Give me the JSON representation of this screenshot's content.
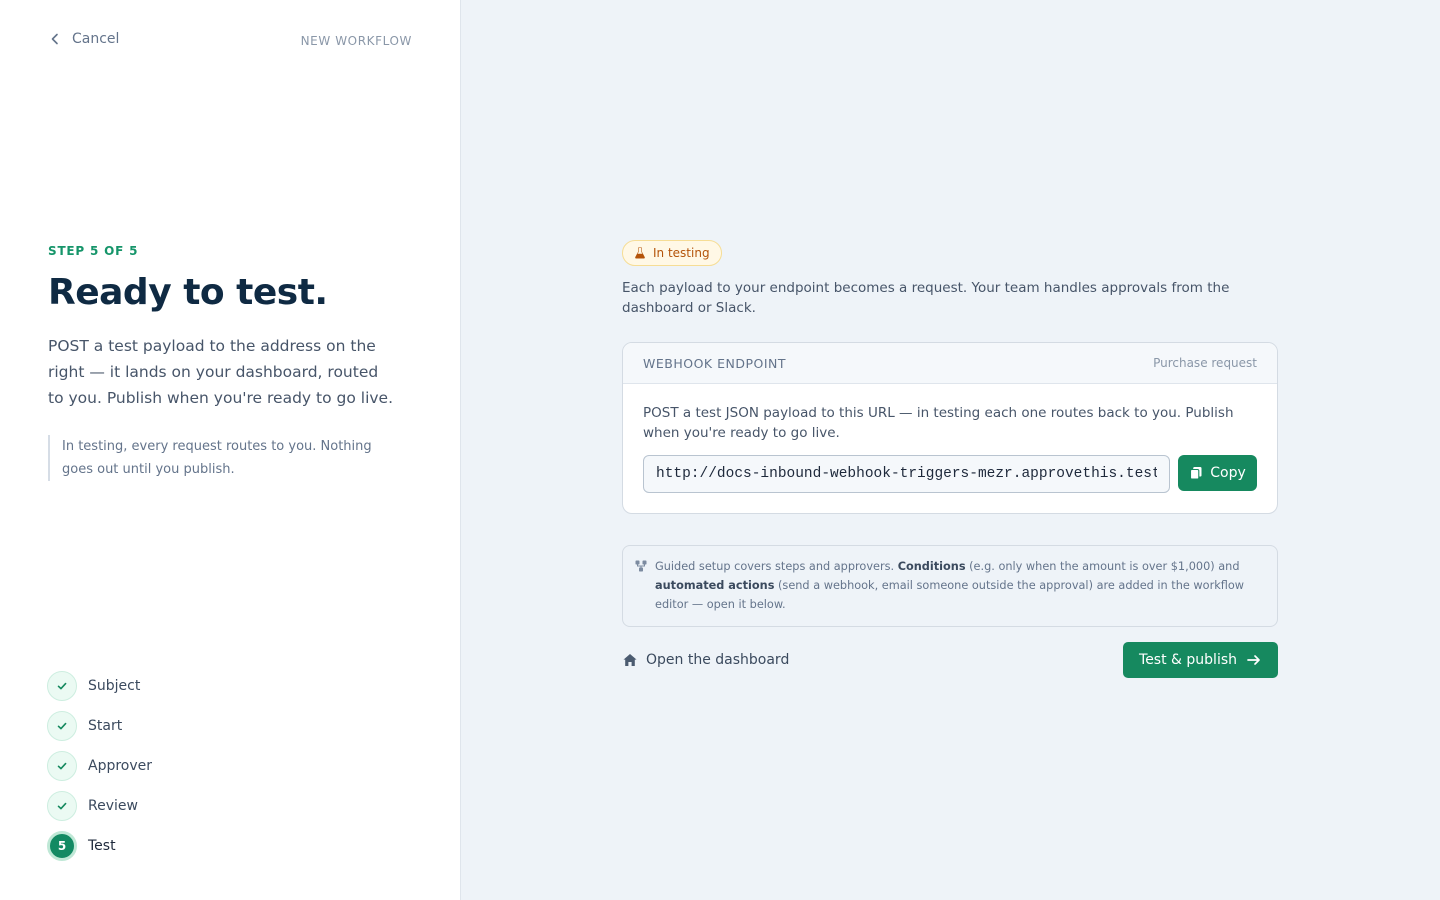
{
  "header": {
    "cancel_label": "Cancel",
    "context_label": "NEW WORKFLOW"
  },
  "intro": {
    "step_counter": "STEP 5 OF 5",
    "title": "Ready to test.",
    "description": "POST a test payload to the address on the right — it lands on your dashboard, routed to you. Publish when you're ready to go live.",
    "note": "In testing, every request routes to you. Nothing goes out until you publish."
  },
  "steps": [
    {
      "label": "Subject",
      "status": "done"
    },
    {
      "label": "Start",
      "status": "done"
    },
    {
      "label": "Approver",
      "status": "done"
    },
    {
      "label": "Review",
      "status": "done"
    },
    {
      "label": "Test",
      "status": "active",
      "number": "5"
    }
  ],
  "main": {
    "badge": "In testing",
    "intro": "Each payload to your endpoint becomes a request. Your team handles approvals from the dashboard or Slack.",
    "card": {
      "title": "WEBHOOK ENDPOINT",
      "subtitle": "Purchase request",
      "body": "POST a test JSON payload to this URL — in testing each one routes back to you. Publish when you're ready to go live.",
      "url": "http://docs-inbound-webhook-triggers-mezr.approvethis.test/api/webhooks/inbound",
      "copy_label": "Copy"
    },
    "info": {
      "text_1": "Guided setup covers steps and approvers. ",
      "bold_1": "Conditions",
      "text_2": " (e.g. only when the amount is over $1,000) and ",
      "bold_2": "automated actions",
      "text_3": " (send a webhook, email someone outside the approval) are added in the workflow editor — open it below."
    },
    "dashboard_link": "Open the dashboard",
    "publish_label": "Test & publish"
  },
  "colors": {
    "accent": "#16895f",
    "badge_text": "#b45309",
    "badge_bg": "#fff8e6",
    "title": "#0f2a43"
  }
}
